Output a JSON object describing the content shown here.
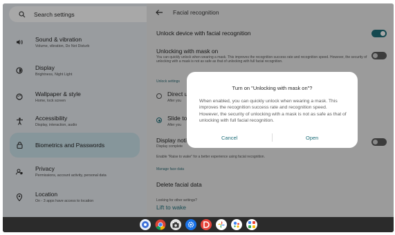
{
  "search": {
    "placeholder": "Search settings"
  },
  "sidebar": {
    "items": [
      {
        "title": "Sound & vibration",
        "subtitle": "Volume, vibration, Do Not Disturb",
        "icon": "speaker-icon"
      },
      {
        "title": "Display",
        "subtitle": "Brightness, Night Light",
        "icon": "brightness-icon"
      },
      {
        "title": "Wallpaper & style",
        "subtitle": "Home, lock screen",
        "icon": "palette-icon"
      },
      {
        "title": "Accessibility",
        "subtitle": "Display, interaction, audio",
        "icon": "accessibility-icon"
      },
      {
        "title": "Biometrics and Passwords",
        "subtitle": "",
        "icon": "lock-icon",
        "active": true
      },
      {
        "title": "Privacy",
        "subtitle": "Permissions, account activity, personal data",
        "icon": "privacy-icon"
      },
      {
        "title": "Location",
        "subtitle": "On - 3 apps have access to location",
        "icon": "location-icon"
      }
    ]
  },
  "main": {
    "title": "Facial recognition",
    "unlock_device": {
      "label": "Unlock device with facial recognition",
      "on": true
    },
    "mask": {
      "label": "Unlocking with mask on",
      "desc": "You can quickly unlock when wearing a mask. This improves the recognition success rate and recognition speed. However, the security of unlocking with a mask is not as safe as that of unlocking with full facial recognition.",
      "on": false
    },
    "unlock_settings_label": "Unlock settings",
    "option_direct": {
      "label": "Direct u",
      "sub": "After you"
    },
    "option_slide": {
      "label": "Slide to",
      "sub": "After you"
    },
    "display_noti": {
      "label": "Display notifi",
      "sub": "Display complete",
      "on": false
    },
    "raise_note": "Enable \"Raise to wake\" for a better experience using facial recognition.",
    "manage_label": "Manage face data",
    "delete_label": "Delete facial data",
    "looking_label": "Looking for other settings?",
    "lift_label": "Lift to wake"
  },
  "dialog": {
    "title": "Turn on \"Unlocking with mask on\"?",
    "body": "When enabled, you can quickly unlock when wearing a mask. This improves the recognition success rate and recognition speed. However, the security of unlocking with a mask is not as safe as that of unlocking with full facial recognition.",
    "cancel": "Cancel",
    "open": "Open"
  },
  "colors": {
    "accent": "#1f6f7a",
    "active_nav": "#cce4ec",
    "sidebar": "#e9edf2"
  },
  "shelf": {
    "apps": [
      "launcher-icon",
      "chrome-icon",
      "camera-icon",
      "settings-icon",
      "app-d-icon",
      "photos-icon",
      "assistant-icon",
      "app-grid-icon"
    ]
  }
}
